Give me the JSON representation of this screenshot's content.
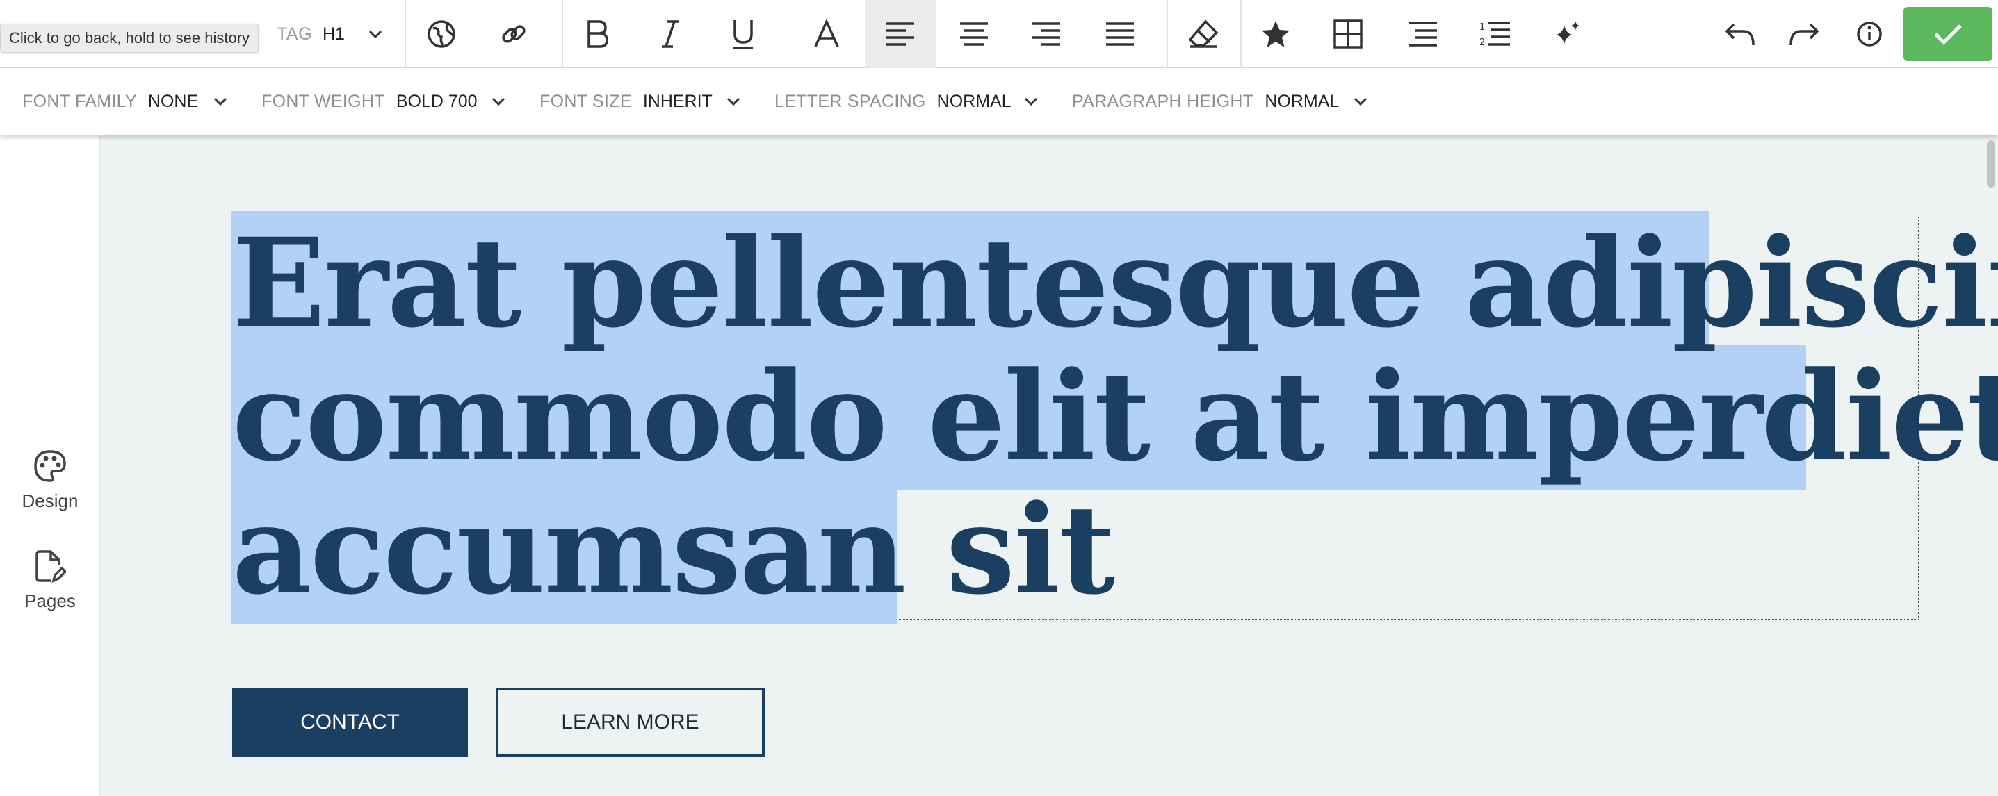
{
  "tooltip": "Click to go back, hold to see history",
  "toolbar": {
    "tag_label": "TAG",
    "tag_value": "H1",
    "icons": [
      "globe-icon",
      "link-icon",
      "bold-icon",
      "italic-icon",
      "underline-icon",
      "text-color-icon",
      "align-left-icon",
      "align-center-icon",
      "align-right-icon",
      "align-justify-icon",
      "eraser-icon",
      "star-icon",
      "table-icon",
      "list-icon",
      "numbered-list-icon",
      "sparkle-icon",
      "undo-icon",
      "redo-icon",
      "info-icon",
      "check-icon"
    ],
    "confirm_color": "#5cb85c"
  },
  "typography": {
    "font_family": {
      "label": "FONT FAMILY",
      "value": "NONE"
    },
    "font_weight": {
      "label": "FONT WEIGHT",
      "value": "BOLD 700"
    },
    "font_size": {
      "label": "FONT SIZE",
      "value": "INHERIT"
    },
    "letter_spacing": {
      "label": "LETTER SPACING",
      "value": "NORMAL"
    },
    "paragraph_height": {
      "label": "PARAGRAPH HEIGHT",
      "value": "NORMAL"
    }
  },
  "sidebar": {
    "items": [
      {
        "label": "Design",
        "icon": "palette-icon"
      },
      {
        "label": "Pages",
        "icon": "page-edit-icon"
      }
    ]
  },
  "canvas": {
    "headline_lines": [
      "Erat pellentesque adipiscing",
      "commodo elit at imperdiet dui",
      "accumsan sit"
    ],
    "buttons": {
      "contact": "CONTACT",
      "learn_more": "LEARN MORE"
    },
    "colors": {
      "background": "#ecf3f2",
      "primary": "#1b3f60",
      "selection": "#b3d1f5"
    }
  }
}
